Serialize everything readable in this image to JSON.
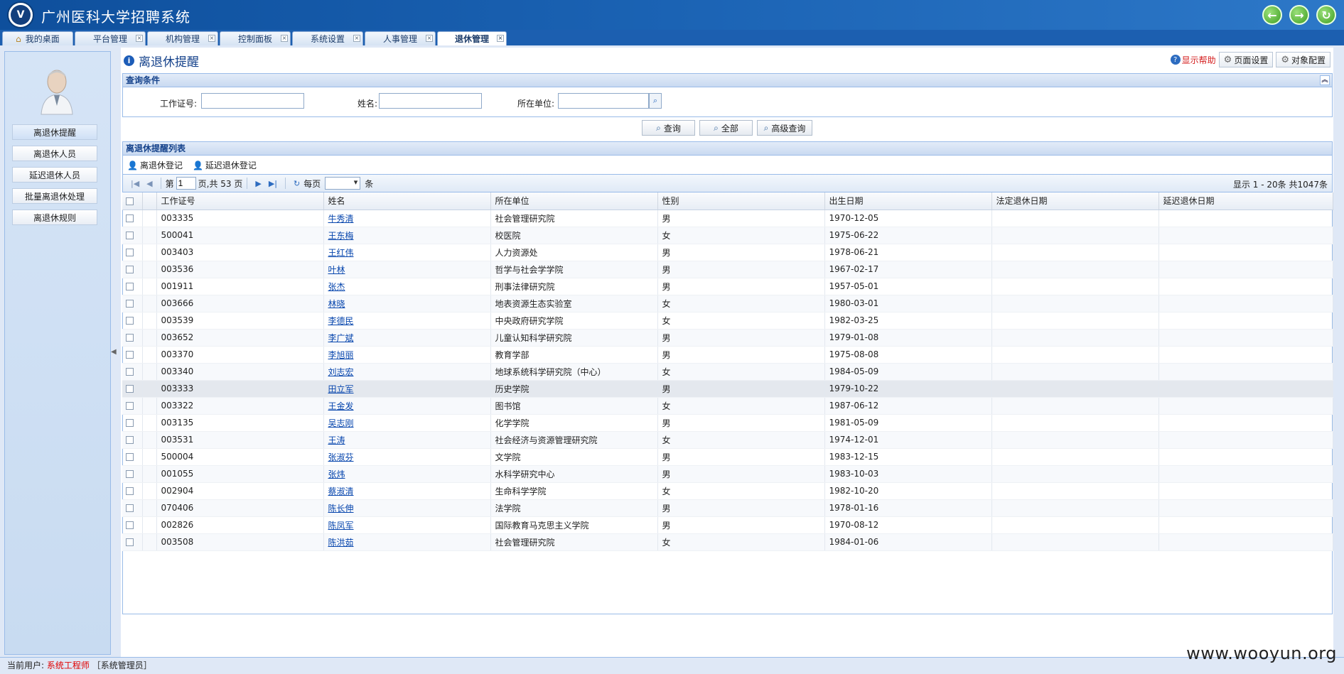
{
  "app": {
    "title": "广州医科大学招聘系统",
    "logo_text": "V"
  },
  "header_buttons": [
    {
      "name": "back-button",
      "glyph": "←"
    },
    {
      "name": "forward-button",
      "glyph": "→"
    },
    {
      "name": "refresh-button",
      "glyph": "↻"
    }
  ],
  "tabs": [
    {
      "label": "我的桌面",
      "active": false
    },
    {
      "label": "平台管理",
      "active": false
    },
    {
      "label": "机构管理",
      "active": false
    },
    {
      "label": "控制面板",
      "active": false
    },
    {
      "label": "系统设置",
      "active": false
    },
    {
      "label": "人事管理",
      "active": false
    },
    {
      "label": "退休管理",
      "active": true
    }
  ],
  "sidebar": {
    "items": [
      {
        "label": "离退休提醒",
        "active": true
      },
      {
        "label": "离退休人员",
        "active": false
      },
      {
        "label": "延迟退休人员",
        "active": false
      },
      {
        "label": "批量离退休处理",
        "active": false
      },
      {
        "label": "离退休规则",
        "active": false
      }
    ]
  },
  "page": {
    "title": "离退休提醒",
    "help_label": "显示帮助",
    "page_settings_label": "页面设置",
    "object_config_label": "对象配置"
  },
  "query": {
    "section_title": "查询条件",
    "employee_id_label": "工作证号:",
    "name_label": "姓名:",
    "unit_label": "所在单位:",
    "employee_id_value": "",
    "name_value": "",
    "unit_value": "",
    "search_label": "查询",
    "all_label": "全部",
    "advanced_label": "高级查询"
  },
  "list": {
    "section_title": "离退休提醒列表",
    "toolbar": {
      "retire_register": "离退休登记",
      "delay_register": "延迟退休登记"
    },
    "pager": {
      "page_prefix": "第",
      "current_page": "1",
      "page_suffix": "页,共 53 页",
      "per_page_label": "每页",
      "per_page_unit": "条",
      "display_text": "显示 1 - 20条 共1047条"
    },
    "columns": [
      "工作证号",
      "姓名",
      "所在单位",
      "性别",
      "出生日期",
      "法定退休日期",
      "延迟退休日期"
    ],
    "rows": [
      {
        "id": "003335",
        "name": "牛秀清",
        "unit": "社会管理研究院",
        "gender": "男",
        "birth": "1970-12-05",
        "legal": "",
        "delay": ""
      },
      {
        "id": "500041",
        "name": "王东梅",
        "unit": "校医院",
        "gender": "女",
        "birth": "1975-06-22",
        "legal": "",
        "delay": ""
      },
      {
        "id": "003403",
        "name": "王红伟",
        "unit": "人力资源处",
        "gender": "男",
        "birth": "1978-06-21",
        "legal": "",
        "delay": ""
      },
      {
        "id": "003536",
        "name": "叶林",
        "unit": "哲学与社会学学院",
        "gender": "男",
        "birth": "1967-02-17",
        "legal": "",
        "delay": ""
      },
      {
        "id": "001911",
        "name": "张杰",
        "unit": "刑事法律研究院",
        "gender": "男",
        "birth": "1957-05-01",
        "legal": "",
        "delay": ""
      },
      {
        "id": "003666",
        "name": "林晓",
        "unit": "地表资源生态实验室",
        "gender": "女",
        "birth": "1980-03-01",
        "legal": "",
        "delay": ""
      },
      {
        "id": "003539",
        "name": "李德民",
        "unit": "中央政府研究学院",
        "gender": "女",
        "birth": "1982-03-25",
        "legal": "",
        "delay": ""
      },
      {
        "id": "003652",
        "name": "李广斌",
        "unit": "儿童认知科学研究院",
        "gender": "男",
        "birth": "1979-01-08",
        "legal": "",
        "delay": ""
      },
      {
        "id": "003370",
        "name": "李旭丽",
        "unit": "教育学部",
        "gender": "男",
        "birth": "1975-08-08",
        "legal": "",
        "delay": ""
      },
      {
        "id": "003340",
        "name": "刘志宏",
        "unit": "地球系统科学研究院（中心）",
        "gender": "女",
        "birth": "1984-05-09",
        "legal": "",
        "delay": ""
      },
      {
        "id": "003333",
        "name": "田立军",
        "unit": "历史学院",
        "gender": "男",
        "birth": "1979-10-22",
        "legal": "",
        "delay": ""
      },
      {
        "id": "003322",
        "name": "王金发",
        "unit": "图书馆",
        "gender": "女",
        "birth": "1987-06-12",
        "legal": "",
        "delay": ""
      },
      {
        "id": "003135",
        "name": "吴志刚",
        "unit": "化学学院",
        "gender": "男",
        "birth": "1981-05-09",
        "legal": "",
        "delay": ""
      },
      {
        "id": "003531",
        "name": "王涛",
        "unit": "社会经济与资源管理研究院",
        "gender": "女",
        "birth": "1974-12-01",
        "legal": "",
        "delay": ""
      },
      {
        "id": "500004",
        "name": "张淑芬",
        "unit": "文学院",
        "gender": "男",
        "birth": "1983-12-15",
        "legal": "",
        "delay": ""
      },
      {
        "id": "001055",
        "name": "张炜",
        "unit": "水科学研究中心",
        "gender": "男",
        "birth": "1983-10-03",
        "legal": "",
        "delay": ""
      },
      {
        "id": "002904",
        "name": "蔡淑清",
        "unit": "生命科学学院",
        "gender": "女",
        "birth": "1982-10-20",
        "legal": "",
        "delay": ""
      },
      {
        "id": "070406",
        "name": "陈长伸",
        "unit": "法学院",
        "gender": "男",
        "birth": "1978-01-16",
        "legal": "",
        "delay": ""
      },
      {
        "id": "002826",
        "name": "陈凤军",
        "unit": "国际教育马克思主义学院",
        "gender": "男",
        "birth": "1970-08-12",
        "legal": "",
        "delay": ""
      },
      {
        "id": "003508",
        "name": "陈洪茹",
        "unit": "社会管理研究院",
        "gender": "女",
        "birth": "1984-01-06",
        "legal": "",
        "delay": ""
      }
    ],
    "highlighted_row": 10
  },
  "status": {
    "prefix": "当前用户:",
    "user": "系统工程师",
    "role": "［系统管理员］"
  },
  "watermark": "www.wooyun.org"
}
